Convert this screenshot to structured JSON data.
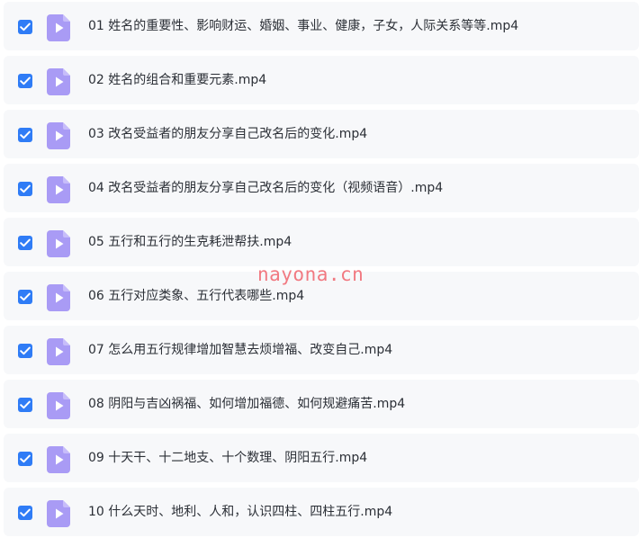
{
  "files": [
    {
      "name": "01 姓名的重要性、影响财运、婚姻、事业、健康，子女，人际关系等等.mp4",
      "checked": true
    },
    {
      "name": "02 姓名的组合和重要元素.mp4",
      "checked": true
    },
    {
      "name": "03 改名受益者的朋友分享自己改名后的变化.mp4",
      "checked": true
    },
    {
      "name": "04 改名受益者的朋友分享自己改名后的变化（视频语音）.mp4",
      "checked": true
    },
    {
      "name": "05 五行和五行的生克耗泄帮扶.mp4",
      "checked": true
    },
    {
      "name": "06 五行对应类象、五行代表哪些.mp4",
      "checked": true
    },
    {
      "name": "07 怎么用五行规律增加智慧去烦增福、改变自己.mp4",
      "checked": true
    },
    {
      "name": "08 阴阳与吉凶祸福、如何增加福德、如何规避痛苦.mp4",
      "checked": true
    },
    {
      "name": "09 十天干、十二地支、十个数理、阴阳五行.mp4",
      "checked": true
    },
    {
      "name": "10 什么天时、地利、人和，认识四柱、四柱五行.mp4",
      "checked": true
    }
  ],
  "watermark": "nayona.cn",
  "colors": {
    "checkbox": "#2f7cf6",
    "file_icon": "#a99bf5",
    "row_bg": "#f7f8fa",
    "watermark": "#f05a64"
  },
  "icons": {
    "checkbox": "checkmark-icon",
    "file": "video-file-icon"
  }
}
